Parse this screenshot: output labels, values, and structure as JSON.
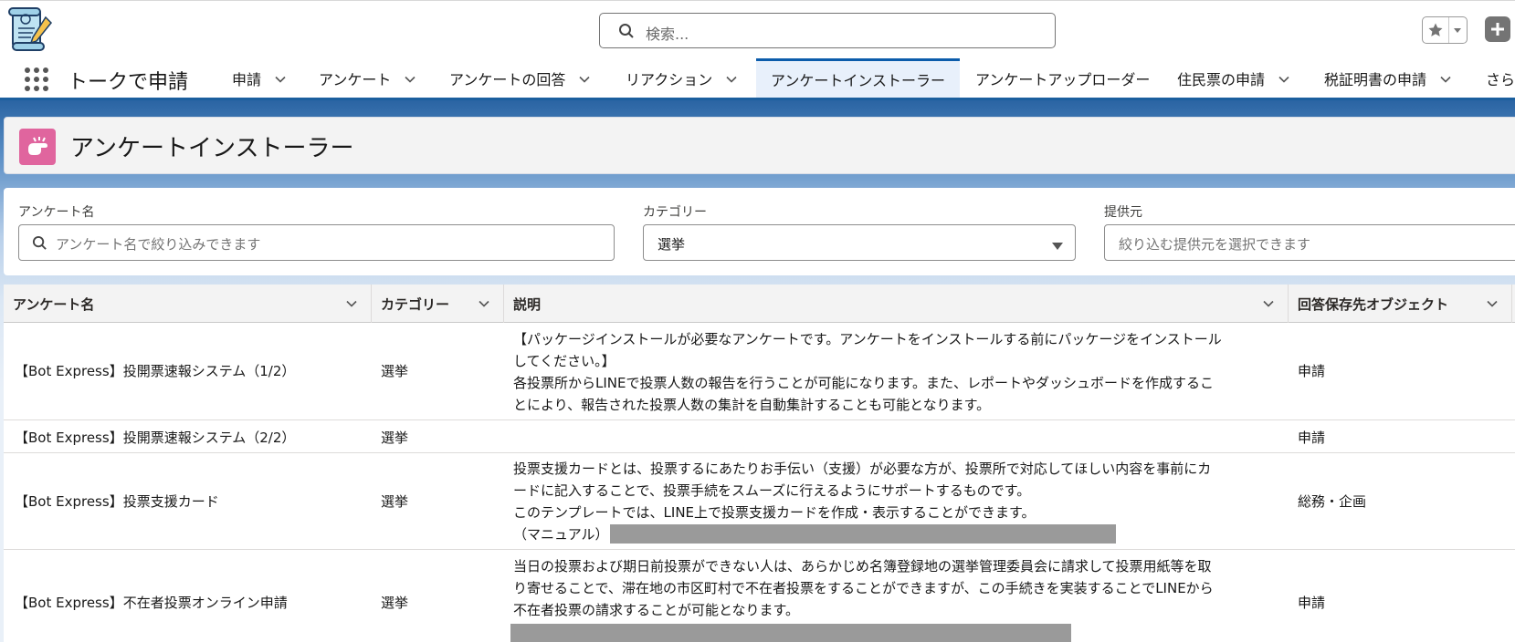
{
  "header": {
    "search_placeholder": "検索...",
    "app_name": "トークで申請"
  },
  "nav": {
    "items": [
      {
        "label": "申請"
      },
      {
        "label": "アンケート"
      },
      {
        "label": "アンケートの回答"
      },
      {
        "label": "リアクション"
      },
      {
        "label": "アンケートインストーラー"
      },
      {
        "label": "アンケートアップローダー"
      },
      {
        "label": "住民票の申請"
      },
      {
        "label": "税証明書の申請"
      },
      {
        "label": "さら"
      }
    ],
    "active_index": 4
  },
  "page": {
    "title": "アンケートインストーラー"
  },
  "filters": {
    "survey_name_label": "アンケート名",
    "survey_name_placeholder": "アンケート名で絞り込みできます",
    "category_label": "カテゴリー",
    "category_value": "選挙",
    "provider_label": "提供元",
    "provider_placeholder": "絞り込む提供元を選択できます"
  },
  "table": {
    "columns": [
      "アンケート名",
      "カテゴリー",
      "説明",
      "回答保存先オブジェクト"
    ],
    "rows": [
      {
        "name": "【Bot Express】投開票速報システム（1/2）",
        "category": "選挙",
        "description_lines": [
          "【パッケージインストールが必要なアンケートです。アンケートをインストールする前にパッケージをインストール",
          "してください。】",
          "各投票所からLINEで投票人数の報告を行うことが可能になります。また、レポートやダッシュボードを作成するこ",
          "とにより、報告された投票人数の集計を自動集計することも可能となります。"
        ],
        "object": "申請"
      },
      {
        "name": "【Bot Express】投開票速報システム（2/2）",
        "category": "選挙",
        "description_lines": [],
        "object": "申請"
      },
      {
        "name": "【Bot Express】投票支援カード",
        "category": "選挙",
        "description_lines": [
          "投票支援カードとは、投票するにあたりお手伝い（支援）が必要な方が、投票所で対応してほしい内容を事前にカ",
          "ードに記入することで、投票手続をスムーズに行えるようにサポートするものです。",
          "このテンプレートでは、LINE上で投票支援カードを作成・表示することができます。",
          "（マニュアル）"
        ],
        "object": "総務・企画"
      },
      {
        "name": "【Bot Express】不在者投票オンライン申請",
        "category": "選挙",
        "description_lines": [
          "当日の投票および期日前投票ができない人は、あらかじめ名簿登録地の選挙管理委員会に請求して投票用紙等を取",
          "り寄せることで、滞在地の市区町村で不在者投票をすることができますが、この手続きを実装することでLINEから",
          "不在者投票の請求することが可能となります。"
        ],
        "object": "申請"
      }
    ]
  },
  "colors": {
    "brand_blue": "#0b5cab",
    "page_icon_pink": "#e0659e"
  }
}
